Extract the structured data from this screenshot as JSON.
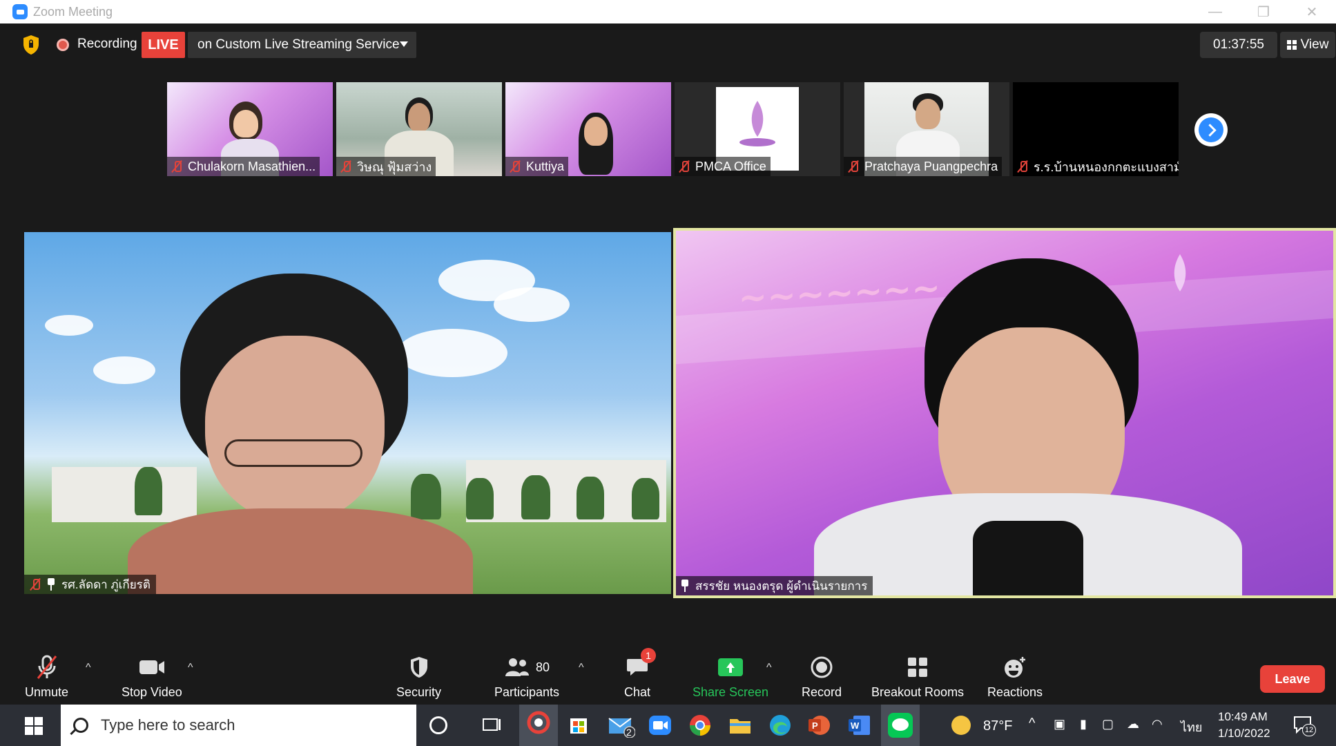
{
  "window": {
    "title": "Zoom Meeting"
  },
  "status": {
    "recording_label": "Recording",
    "live_badge": "LIVE",
    "stream_label": "on Custom Live Streaming Service",
    "timer": "01:37:55",
    "view_label": "View"
  },
  "thumbnails": [
    {
      "name": "Chulakorn Masathien...",
      "muted": true
    },
    {
      "name": "วิษณุ ฟุ้มสว่าง",
      "muted": true
    },
    {
      "name": "Kuttiya",
      "muted": true
    },
    {
      "name": "PMCA Office",
      "muted": true
    },
    {
      "name": "Pratchaya Puangpechra",
      "muted": true
    },
    {
      "name": "ร.ร.บ้านหนองกกตะแบงสามั...",
      "muted": true
    }
  ],
  "main_videos": [
    {
      "name": "รศ.ลัดดา ภู่เกียรติ",
      "muted": true,
      "pinned": true
    },
    {
      "name": "สรรชัย หนองตรุด ผู้ดำเนินรายการ",
      "muted": false,
      "pinned": true,
      "active_speaker": true
    }
  ],
  "toolbar": {
    "unmute": "Unmute",
    "stop_video": "Stop Video",
    "security": "Security",
    "participants": "Participants",
    "participants_count": "80",
    "chat": "Chat",
    "chat_badge": "1",
    "share_screen": "Share Screen",
    "record": "Record",
    "breakout_rooms": "Breakout Rooms",
    "reactions": "Reactions",
    "leave": "Leave"
  },
  "taskbar": {
    "search_placeholder": "Type here to search",
    "mail_badge": "2",
    "weather": "87°F",
    "language": "ไทย",
    "time": "10:49 AM",
    "date": "1/10/2022",
    "notifications": "12"
  },
  "colors": {
    "live_red": "#e8423a",
    "zoom_blue": "#2d8cff",
    "share_green": "#27c65a",
    "active_speaker_border": "#e3e6a2"
  }
}
